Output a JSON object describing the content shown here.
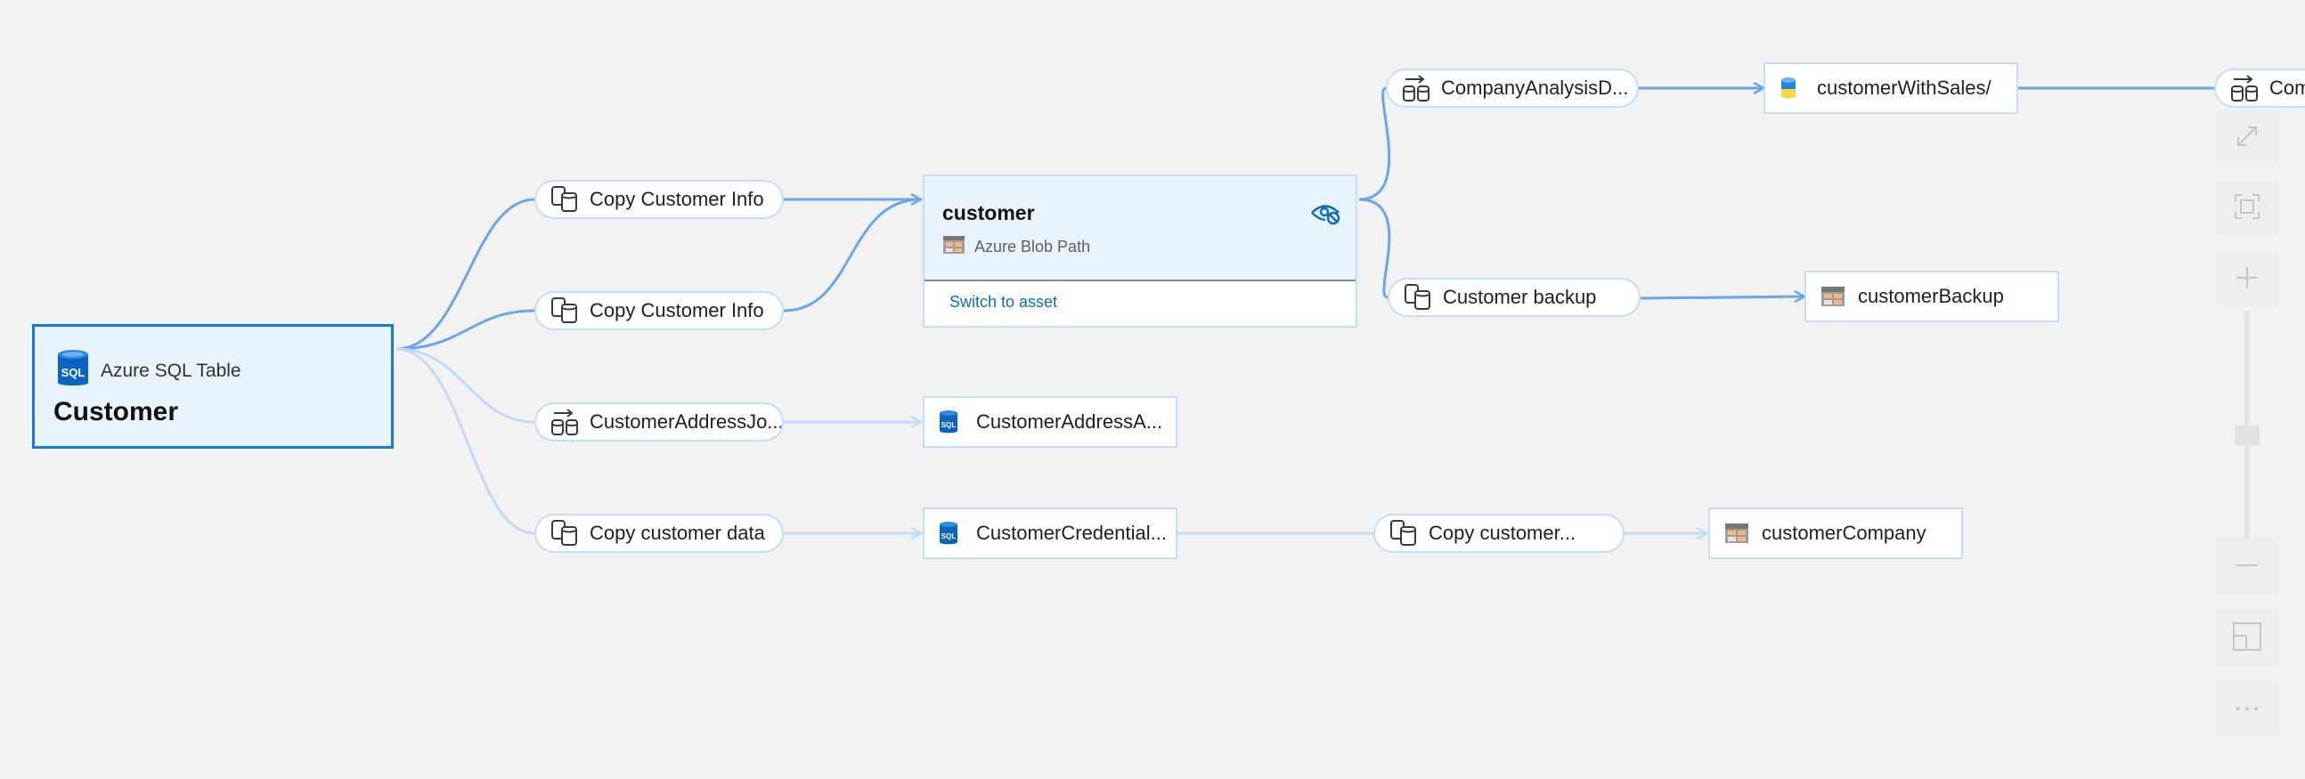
{
  "root": {
    "type_label": "Azure SQL Table",
    "title": "Customer",
    "icon": "sql-database-icon"
  },
  "focus": {
    "name": "customer",
    "type_label": "Azure Blob Path",
    "link": "Switch to asset",
    "icon": "blob-storage-icon",
    "action_icon": "hide-eye-icon"
  },
  "processes": [
    {
      "label": "Copy Customer Info",
      "icon": "copy-process-icon"
    },
    {
      "label": "Copy Customer Info",
      "icon": "copy-process-icon"
    },
    {
      "label": "CustomerAddressJo...",
      "icon": "dataflow-process-icon"
    },
    {
      "label": "Copy customer data",
      "icon": "copy-process-icon"
    },
    {
      "label": "CompanyAnalysisD...",
      "icon": "dataflow-process-icon"
    },
    {
      "label": "Customer backup",
      "icon": "copy-process-icon"
    },
    {
      "label": "Copy customer...",
      "icon": "copy-process-icon"
    },
    {
      "label": "Com",
      "icon": "dataflow-process-icon"
    }
  ],
  "assets": [
    {
      "label": "CustomerAddressA...",
      "icon": "sql-database-icon"
    },
    {
      "label": "CustomerCredential...",
      "icon": "sql-database-icon"
    },
    {
      "label": "customerWithSales/",
      "icon": "data-lake-icon"
    },
    {
      "label": "customerBackup",
      "icon": "blob-storage-icon"
    },
    {
      "label": "customerCompany",
      "icon": "blob-storage-icon"
    }
  ],
  "toolbar": {
    "buttons": [
      "expand-icon",
      "fit-to-screen-icon",
      "zoom-in-icon",
      "zoom-out-icon",
      "minimap-icon",
      "more-options-icon"
    ]
  },
  "colors": {
    "accent": "#1a79d6",
    "edge": "#6aa5ee",
    "edge_faded": "#c3dbf6",
    "node_border": "#c7dcf6",
    "focus_bg": "#e9f3fc",
    "canvas": "#f2f2f2"
  }
}
